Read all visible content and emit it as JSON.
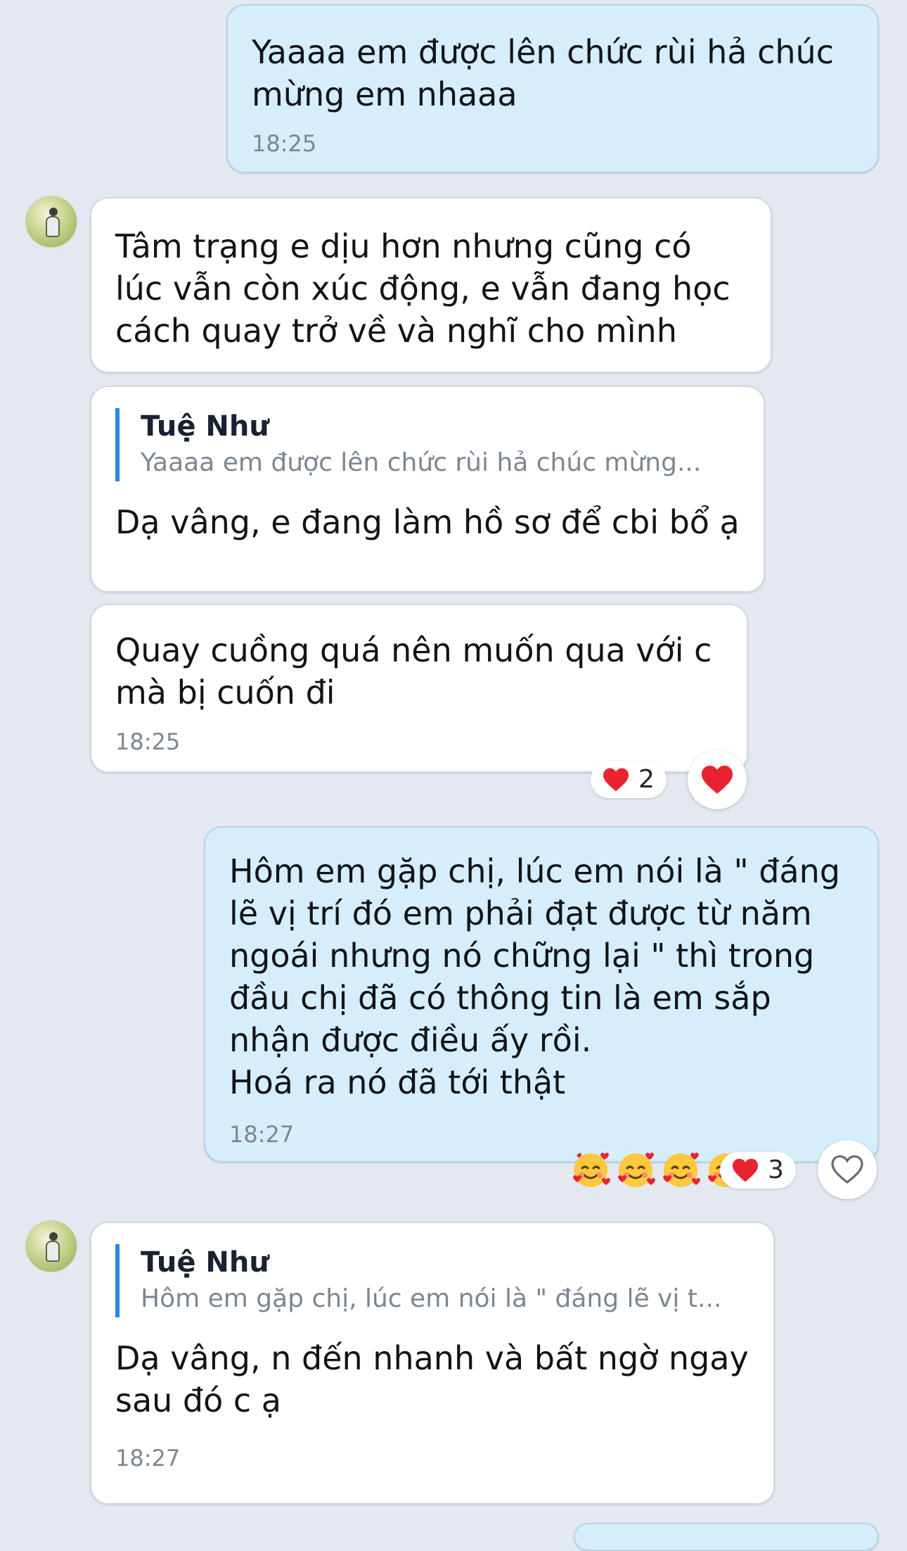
{
  "contact": {
    "quoted_name": "Tuệ Như"
  },
  "messages": [
    {
      "id": "m1",
      "direction": "outgoing",
      "text": "Yaaaa em được lên chức rùi hả chúc\nmừng em nhaaa",
      "time": "18:25"
    },
    {
      "id": "m2",
      "direction": "incoming",
      "text": "Tâm trạng e dịu hơn nhưng cũng có\nlúc vẫn còn xúc động, e vẫn đang học\ncách quay trở về và nghĩ cho mình"
    },
    {
      "id": "m3",
      "direction": "incoming",
      "quote": {
        "name": "Tuệ Như",
        "text": "Yaaaa em được lên chức rùi hả chúc mừng..."
      },
      "text": "Dạ vâng, e đang làm hồ sơ để cbi bổ ạ"
    },
    {
      "id": "m4",
      "direction": "incoming",
      "text": "Quay cuồng quá nên muốn qua với c\nmà bị cuốn đi",
      "time": "18:25",
      "reaction": {
        "icon": "heart-icon",
        "count": "2",
        "button_icon": "heart-filled-icon"
      }
    },
    {
      "id": "m5",
      "direction": "outgoing",
      "text": "Hôm em gặp chị, lúc em nói là \" đáng\nlẽ vị trí đó em phải đạt được từ năm\nngoái nhưng nó chững lại \" thì trong\nđầu chị đã có thông tin là em sắp\nnhận được điều ấy rồi.\nHoá ra nó đã tới thật",
      "emojis": [
        "smiling-face-with-hearts-icon",
        "smiling-face-with-hearts-icon",
        "smiling-face-with-hearts-icon",
        "smiling-face-with-hearts-icon"
      ],
      "time": "18:27",
      "reaction": {
        "icon": "heart-icon",
        "count": "3",
        "button_icon": "heart-outline-icon"
      }
    },
    {
      "id": "m6",
      "direction": "incoming",
      "quote": {
        "name": "Tuệ Như",
        "text": "Hôm em gặp chị, lúc em nói là \" đáng lẽ vị t..."
      },
      "text": "Dạ vâng, n đến nhanh và bất ngờ ngay\nsau đó c ạ",
      "time": "18:27"
    }
  ],
  "colors": {
    "background": "#e3e8f1",
    "outgoing_bubble": "#d6edfb",
    "incoming_bubble": "#ffffff",
    "quote_bar": "#2a86e9",
    "heart": "#e8232f",
    "timestamp": "#7d8692"
  }
}
